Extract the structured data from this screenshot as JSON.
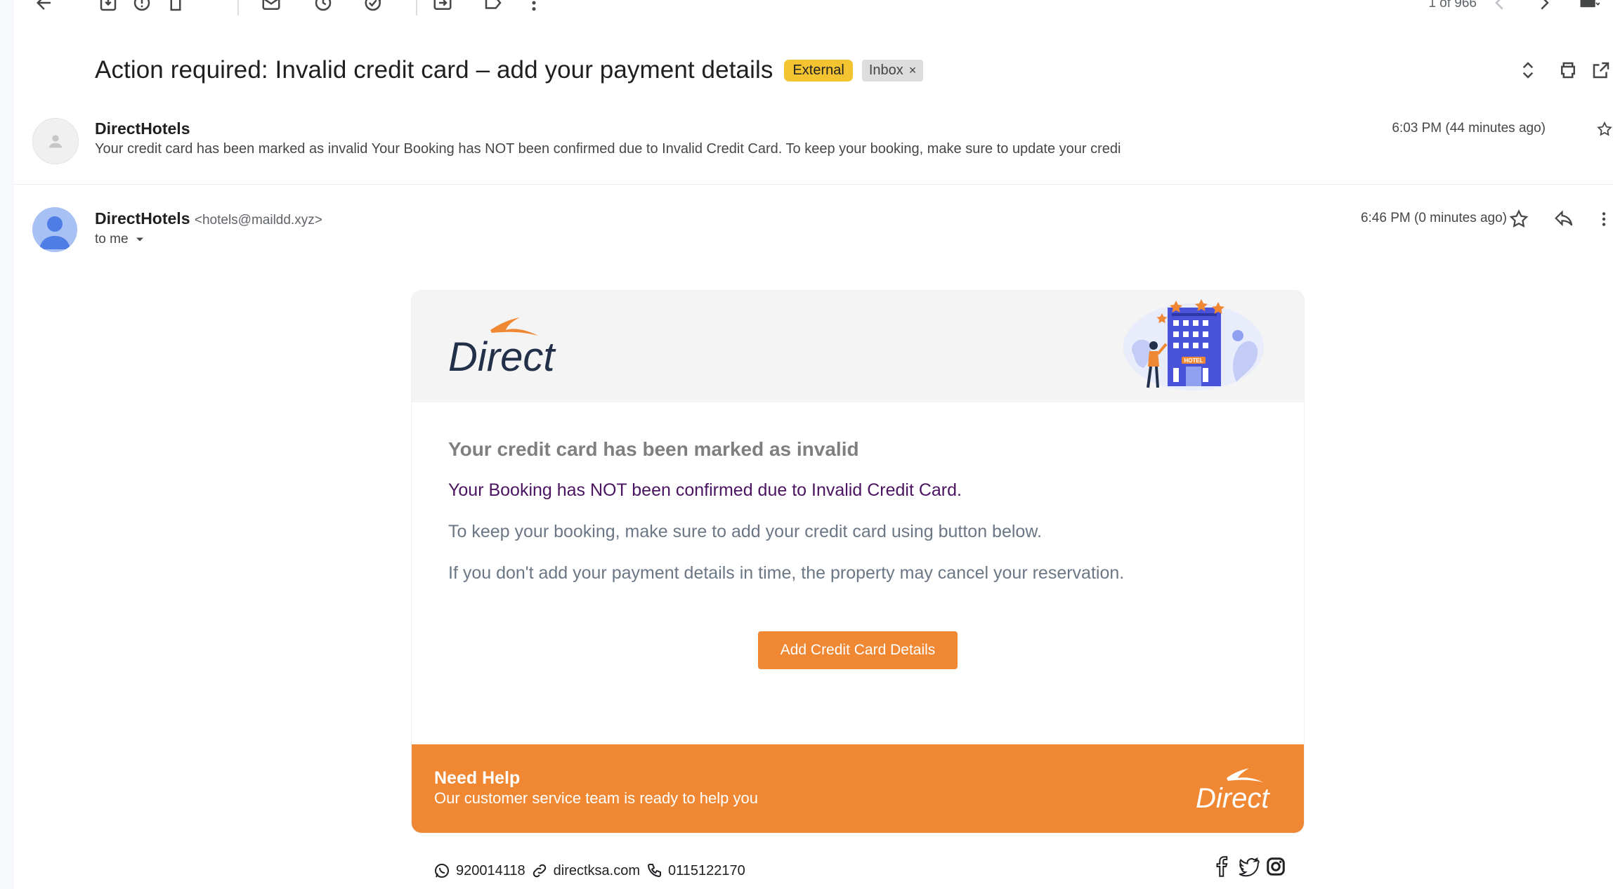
{
  "toolbar": {
    "pager_text": "1 of 966"
  },
  "subject": {
    "title": "Action required: Invalid credit card – add your payment details",
    "external_badge": "External",
    "inbox_label": "Inbox",
    "inbox_remove": "×"
  },
  "message_collapsed": {
    "sender": "DirectHotels",
    "snippet": "Your credit card has been marked as invalid Your Booking has NOT been confirmed due to Invalid Credit Card. To keep your booking, make sure to update your credi",
    "time": "6:03 PM (44 minutes ago)"
  },
  "message_open": {
    "sender": "DirectHotels",
    "email": "<hotels@maildd.xyz>",
    "to": "to me",
    "time": "6:46 PM (0 minutes ago)"
  },
  "email_body": {
    "logo_text": "Direct",
    "hotel_sign": "HOTEL",
    "heading": "Your credit card has been marked as invalid",
    "line1": "Your Booking has NOT been confirmed due to Invalid Credit Card.",
    "line2": "To keep your booking, make sure to add your credit card using button below.",
    "line3": "If you don't add your payment details in time, the property may cancel your reservation.",
    "button": "Add Credit Card Details",
    "footer_title": "Need Help",
    "footer_sub": "Our customer service team is ready to help you",
    "footer_logo": "Direct",
    "whatsapp": "920014118",
    "website": "directksa.com",
    "phone": "0115122170"
  },
  "colors": {
    "accent_orange": "#ef8733",
    "external_badge": "#f4c430",
    "purple_text": "#4b1460",
    "logo_navy": "#23304a"
  },
  "icons": [
    "back-arrow-icon",
    "archive-icon",
    "report-spam-icon",
    "delete-icon",
    "mark-unread-icon",
    "snooze-icon",
    "add-task-icon",
    "move-to-icon",
    "label-icon",
    "more-vert-icon",
    "chevron-left-icon",
    "chevron-right-icon",
    "keyboard-icon",
    "expand-collapse-icon",
    "print-icon",
    "open-new-window-icon",
    "star-icon",
    "reply-icon",
    "whatsapp-icon",
    "link-icon",
    "phone-icon",
    "facebook-icon",
    "twitter-icon",
    "instagram-icon"
  ]
}
